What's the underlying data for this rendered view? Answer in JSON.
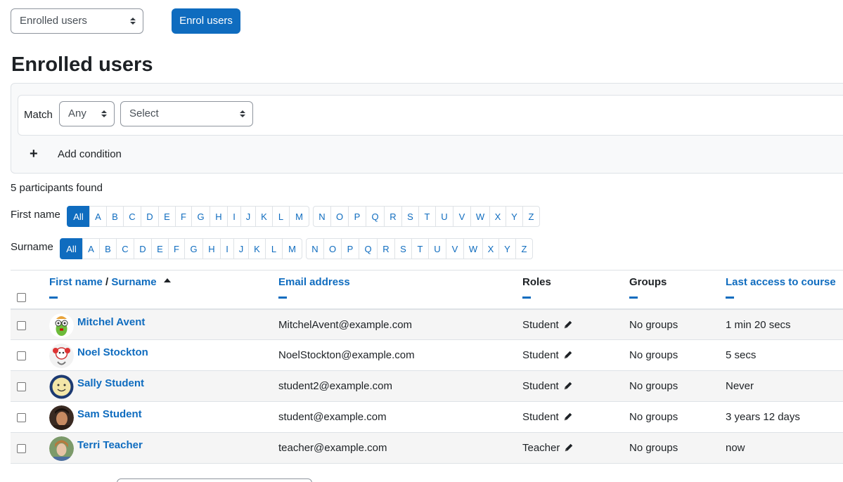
{
  "top": {
    "page_select": "Enrolled users",
    "enrol_button": "Enrol users"
  },
  "heading": "Enrolled users",
  "filter": {
    "match_label": "Match",
    "match_value": "Any",
    "type_value": "Select",
    "add_condition": "Add condition"
  },
  "count_text": "5 participants found",
  "initials": {
    "first_label": "First name",
    "surname_label": "Surname",
    "all": "All",
    "letters": [
      "A",
      "B",
      "C",
      "D",
      "E",
      "F",
      "G",
      "H",
      "I",
      "J",
      "K",
      "L",
      "M",
      "N",
      "O",
      "P",
      "Q",
      "R",
      "S",
      "T",
      "U",
      "V",
      "W",
      "X",
      "Y",
      "Z"
    ]
  },
  "table": {
    "headers": {
      "first_name": "First name",
      "sep": " / ",
      "surname": "Surname",
      "email": "Email address",
      "roles": "Roles",
      "groups": "Groups",
      "last_access": "Last access to course"
    },
    "rows": [
      {
        "name": "Mitchel Avent",
        "email": "MitchelAvent@example.com",
        "role": "Student",
        "groups": "No groups",
        "last_access": "1 min 20 secs",
        "avatar": "green-monster"
      },
      {
        "name": "Noel Stockton",
        "email": "NoelStockton@example.com",
        "role": "Student",
        "groups": "No groups",
        "last_access": "5 secs",
        "avatar": "red-mascot"
      },
      {
        "name": "Sally Student",
        "email": "student2@example.com",
        "role": "Student",
        "groups": "No groups",
        "last_access": "Never",
        "avatar": "smiley"
      },
      {
        "name": "Sam Student",
        "email": "student@example.com",
        "role": "Student",
        "groups": "No groups",
        "last_access": "3 years 12 days",
        "avatar": "photo-man"
      },
      {
        "name": "Terri Teacher",
        "email": "teacher@example.com",
        "role": "Teacher",
        "groups": "No groups",
        "last_access": "now",
        "avatar": "photo-woman"
      }
    ]
  },
  "colors": {
    "primary": "#0f6cbf",
    "text": "#1d2125",
    "border": "#dee2e6",
    "stripe": "#f5f5f5"
  }
}
